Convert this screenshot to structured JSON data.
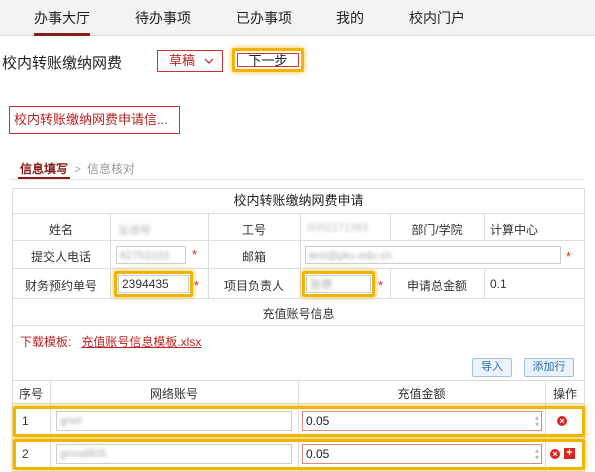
{
  "nav": {
    "tabs": [
      {
        "label": "办事大厅",
        "active": true
      },
      {
        "label": "待办事项",
        "active": false
      },
      {
        "label": "已办事项",
        "active": false
      },
      {
        "label": "我的",
        "active": false
      },
      {
        "label": "校内门户",
        "active": false
      }
    ]
  },
  "header": {
    "title": "校内转账缴纳网费",
    "draft_label": "草稿",
    "next_label": "下一步"
  },
  "form_name": "校内转账缴纳网费申请信...",
  "steps": {
    "current": "信息填写",
    "next": "信息核对"
  },
  "form": {
    "heading": "校内转账缴纳网费申请",
    "name_label": "姓名",
    "name_value": "张德琴",
    "staff_id_label": "工号",
    "staff_id_value": "0002171383",
    "dept_label": "部门/学院",
    "dept_value": "计算中心",
    "phone_label": "提交人电话",
    "phone_value": "62751023",
    "email_label": "邮箱",
    "email_value": "test@pku.edu.cn",
    "order_label": "财务预约单号",
    "order_value": "2394435",
    "pm_label": "项目负责人",
    "pm_value": "张德",
    "total_label": "申请总金额",
    "total_value": "0.1",
    "section_label": "充值账号信息",
    "download_label": "下载模板:",
    "download_link": "充值账号信息模板.xlsx",
    "import_label": "导入",
    "add_row_label": "添加行",
    "columns": [
      "序号",
      "网络账号",
      "充值金额",
      "操作"
    ],
    "rows": [
      {
        "index": "1",
        "account": "gnet",
        "amount": "0.05"
      },
      {
        "index": "2",
        "account": "gmod805",
        "amount": "0.05"
      }
    ],
    "required_mark": "*"
  },
  "colors": {
    "brand": "#8b1a1a",
    "highlight": "#f2b400",
    "danger": "#d22222"
  }
}
